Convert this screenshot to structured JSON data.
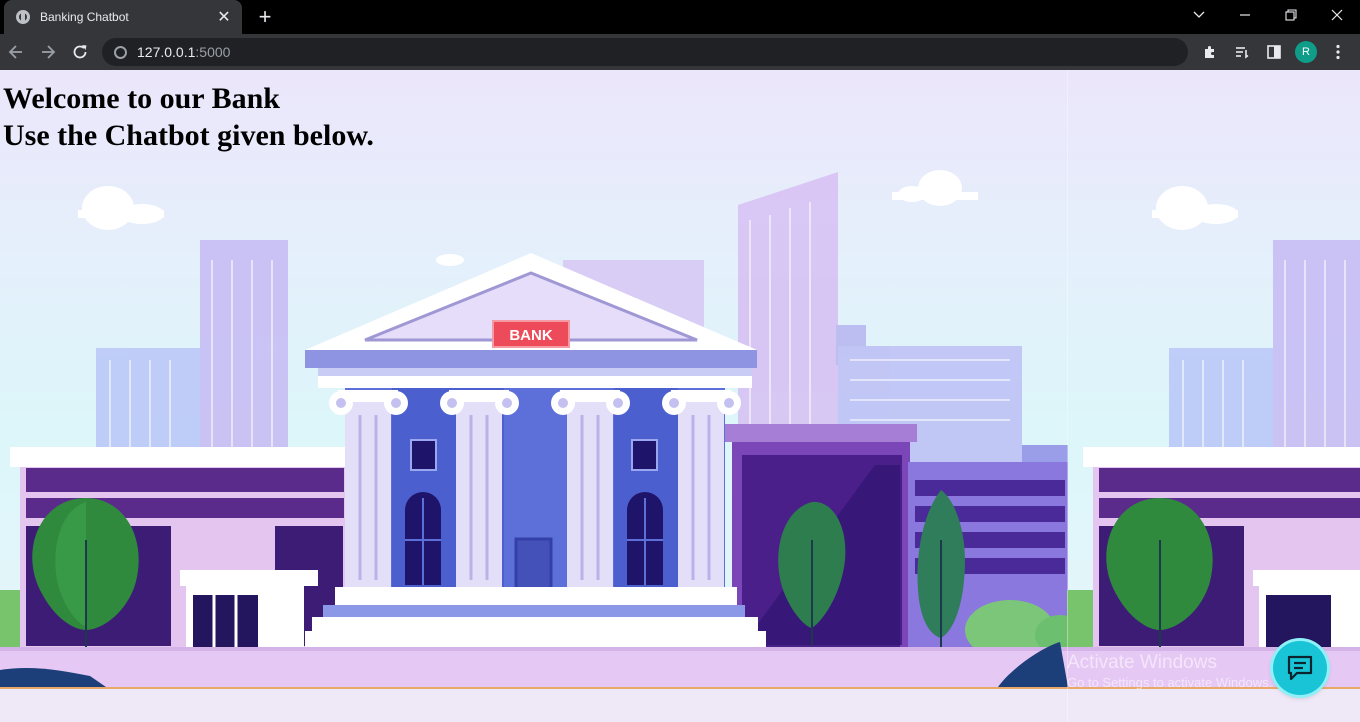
{
  "browser": {
    "tab_title": "Banking Chatbot",
    "url_host": "127.0.0.1",
    "url_port": ":5000",
    "profile_initial": "R"
  },
  "page": {
    "headline_line1": "Welcome to our Bank",
    "headline_line2": "Use the Chatbot given below.",
    "bank_sign": "BANK"
  },
  "watermark": {
    "title": "Activate Windows",
    "subtitle": "Go to Settings to activate Windows."
  },
  "icons": {
    "tab_favicon": "globe-icon",
    "tab_close": "close-icon",
    "new_tab": "plus-icon",
    "back": "arrow-left-icon",
    "forward": "arrow-right-icon",
    "reload": "reload-icon",
    "extensions": "puzzle-icon",
    "reading_list": "reading-list-icon",
    "side_panel": "side-panel-icon",
    "menu": "kebab-menu-icon",
    "chat": "chat-bubble-icon"
  },
  "colors": {
    "chat_button": "#18c4d6",
    "bank_sign": "#ee4b5a",
    "profile": "#0f9d8a"
  }
}
